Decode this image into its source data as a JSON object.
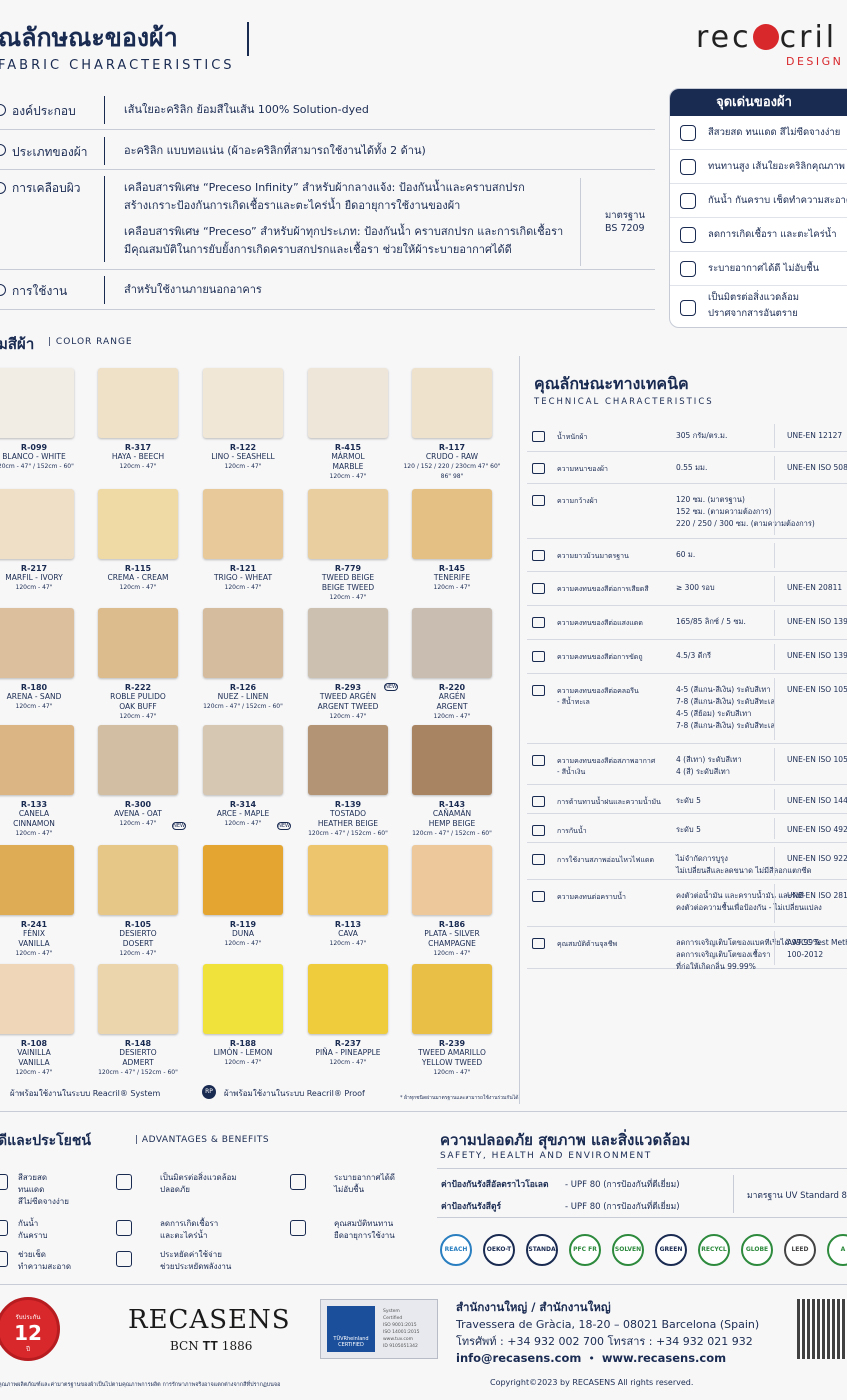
{
  "header": {
    "title_th": "ุณลักษณะของผ้า",
    "title_en": "FABRIC CHARACTERISTICS",
    "logo": "recacril",
    "logo_sub": "DESIGN BY"
  },
  "composition": [
    {
      "label": "องค์ประกอบ",
      "lines": [
        "เส้นใยอะคริลิก ย้อมสีในเส้น 100% Solution-dyed"
      ]
    },
    {
      "label": "ประเภทของผ้า",
      "lines": [
        "อะคริลิก แบบทอแน่น (ผ้าอะคริลิกที่สามารถใช้งานได้ทั้ง 2 ด้าน)"
      ]
    },
    {
      "label": "การเคลือบผิว",
      "lines": [
        "เคลือบสารพิเศษ “Preceso Infinity” สำหรับผ้ากลางแจ้ง: ป้องกันน้ำและคราบสกปรก",
        "สร้างเกราะป้องกันการเกิดเชื้อราและตะไคร่น้ำ ยืดอายุการใช้งานของผ้า",
        "",
        "เคลือบสารพิเศษ “Preceso” สำหรับผ้าทุกประเภท: ป้องกันน้ำ คราบสกปรก และการเกิดเชื้อรา",
        "มีคุณสมบัติในการยับยั้งการเกิดคราบสกปรกและเชื้อรา ช่วยให้ผ้าระบายอากาศได้ดี"
      ]
    },
    {
      "label": "การใช้งาน",
      "lines": [
        "สำหรับใช้งานภายนอกอาคาร"
      ]
    }
  ],
  "standard": {
    "label": "มาตรฐาน",
    "value": "BS 7209"
  },
  "highlights": {
    "title": "จุดเด่นของผ้า",
    "items": [
      {
        "icon": "sun-icon",
        "lines": [
          "สีสวยสด ทนแดด สีไม่ซีดจางง่าย"
        ]
      },
      {
        "icon": "sun-fiber-icon",
        "lines": [
          "ทนทานสูง เส้นใยอะคริลิกคุณภาพ"
        ]
      },
      {
        "icon": "stain-icon",
        "lines": [
          "กันน้ำ กันคราบ เช็ดทำความสะอาด"
        ]
      },
      {
        "icon": "mold-icon",
        "lines": [
          "ลดการเกิดเชื้อรา และตะไคร่น้ำ"
        ]
      },
      {
        "icon": "breathable-icon",
        "lines": [
          "ระบายอากาศได้ดี ไม่อับชื้น"
        ]
      },
      {
        "icon": "eco-icon",
        "lines": [
          "เป็นมิตรต่อสิ่งแวดล้อม",
          "ปราศจากสารอันตราย"
        ]
      }
    ]
  },
  "color_range": {
    "title": "ุมสีผ้า",
    "subtitle": "COLOR RANGE",
    "swatches": [
      {
        "code": "R-099",
        "name": [
          "BLANCO - WHITE"
        ],
        "size": "120cm - 47\" / 152cm - 60\"",
        "color": "#f2ede4"
      },
      {
        "code": "R-317",
        "name": [
          "HAYA - BEECH"
        ],
        "size": "120cm - 47\"",
        "color": "#efe0c8"
      },
      {
        "code": "R-122",
        "name": [
          "LINO - SEASHELL"
        ],
        "size": "120cm - 47\"",
        "color": "#f1e7d6"
      },
      {
        "code": "R-415",
        "name": [
          "MÁRMOL",
          "MARBLE"
        ],
        "size": "120cm - 47\"",
        "color": "#efe6da"
      },
      {
        "code": "R-117",
        "name": [
          "CRUDO - RAW"
        ],
        "size": "120 / 152 / 220 / 230cm 47\" 60\" 86\" 98\"",
        "color": "#eee2cd"
      },
      {
        "code": "R-217",
        "name": [
          "MARFIL - IVORY"
        ],
        "size": "120cm - 47\"",
        "color": "#eedfc6"
      },
      {
        "code": "R-115",
        "name": [
          "CREMA - CREAM"
        ],
        "size": "120cm - 47\"",
        "color": "#efd9a5"
      },
      {
        "code": "R-121",
        "name": [
          "TRIGO - WHEAT"
        ],
        "size": "120cm - 47\"",
        "color": "#e8c99a"
      },
      {
        "code": "R-779",
        "name": [
          "TWEED BEIGE",
          "BEIGE TWEED"
        ],
        "size": "120cm - 47\"",
        "color": "#e9cf9f"
      },
      {
        "code": "R-145",
        "name": [
          "TENERIFE"
        ],
        "size": "120cm - 47\"",
        "color": "#e4c084"
      },
      {
        "code": "R-180",
        "name": [
          "ARENA - SAND"
        ],
        "size": "120cm - 47\"",
        "color": "#dcc09e"
      },
      {
        "code": "R-222",
        "name": [
          "ROBLE PULIDO",
          "OAK BUFF"
        ],
        "size": "120cm - 47\"",
        "color": "#dcbb8d"
      },
      {
        "code": "R-126",
        "name": [
          "NUEZ - LINEN"
        ],
        "size": "120cm - 47\" / 152cm - 60\"",
        "color": "#d6bc9e"
      },
      {
        "code": "R-293",
        "name": [
          "TWEED ARGÉN",
          "ARGENT TWEED"
        ],
        "size": "120cm - 47\"",
        "color": "#ccc0b0"
      },
      {
        "code": "R-220",
        "name": [
          "ARGÉN",
          "ARGENT"
        ],
        "size": "120cm - 47\"",
        "color": "#c8bdb0"
      },
      {
        "code": "R-133",
        "name": [
          "CANELA",
          "CINNAMON"
        ],
        "size": "120cm - 47\"",
        "color": "#dcb585"
      },
      {
        "code": "R-300",
        "name": [
          "AVENA - OAT"
        ],
        "size": "120cm - 47\"",
        "color": "#d2bfa3"
      },
      {
        "code": "R-314",
        "name": [
          "ARCE - MAPLE"
        ],
        "size": "120cm - 47\"",
        "color": "#d6c7b3"
      },
      {
        "code": "R-139",
        "name": [
          "TOSTADO",
          "HEATHER BEIGE"
        ],
        "size": "120cm - 47\" / 152cm - 60\"",
        "color": "#b39474"
      },
      {
        "code": "R-143",
        "name": [
          "CAÑAMÁN",
          "HEMP BEIGE"
        ],
        "size": "120cm - 47\" / 152cm - 60\"",
        "color": "#a98463"
      },
      {
        "code": "R-241",
        "name": [
          "FÉNIX",
          "VANILLA"
        ],
        "size": "120cm - 47\"",
        "color": "#ddac55"
      },
      {
        "code": "R-105",
        "name": [
          "DESIERTO",
          "DOSERT"
        ],
        "size": "120cm - 47\"",
        "color": "#e7c788"
      },
      {
        "code": "R-119",
        "name": [
          "DUNA"
        ],
        "size": "120cm - 47\"",
        "color": "#e5a631"
      },
      {
        "code": "R-113",
        "name": [
          "CAVA"
        ],
        "size": "120cm - 47\"",
        "color": "#edc56c"
      },
      {
        "code": "R-186",
        "name": [
          "PLATA - SILVER",
          "CHAMPAGNE"
        ],
        "size": "120cm - 47\"",
        "color": "#ecc89a"
      },
      {
        "code": "R-108",
        "name": [
          "VAINILLA",
          "VANILLA"
        ],
        "size": "120cm - 47\"",
        "color": "#f0d6b8"
      },
      {
        "code": "R-148",
        "name": [
          "DESIERTO",
          "ADMERT"
        ],
        "size": "120cm - 47\" / 152cm - 60\"",
        "color": "#ead5ac"
      },
      {
        "code": "R-188",
        "name": [
          "LIMÓN - LEMON"
        ],
        "size": "120cm - 47\"",
        "color": "#f0e13b"
      },
      {
        "code": "R-237",
        "name": [
          "PIÑA - PINEAPPLE"
        ],
        "size": "120cm - 47\"",
        "color": "#efcc3c"
      },
      {
        "code": "R-239",
        "name": [
          "TWEED AMARILLO",
          "YELLOW TWEED"
        ],
        "size": "120cm - 47\"",
        "color": "#eabf45"
      }
    ],
    "foot1": "ผ้าพร้อมใช้งานในระบบ Reacril® System",
    "foot2": "ผ้าพร้อมใช้งานในระบบ Reacril® Proof",
    "foot_badge": "RP",
    "note": "* ผ้าทุกชนิดผ่านมาตรฐานและสามารถใช้งานร่วมกันได้",
    "new_badge": "NEW"
  },
  "technical": {
    "title": "คุณลักษณะทางเทคนิค",
    "subtitle": "TECHNICAL CHARACTERISTICS",
    "rows": [
      {
        "label": [
          "น้ำหนักผ้า"
        ],
        "value": [
          "305 กรัม/ตร.ม."
        ],
        "std": [
          "UNE-EN 12127"
        ]
      },
      {
        "label": [
          "ความหนาของผ้า"
        ],
        "value": [
          "0.55 มม."
        ],
        "std": [
          "UNE-EN ISO 5084"
        ]
      },
      {
        "label": [
          "ความกว้างผ้า"
        ],
        "value": [
          "120 ซม. (มาตรฐาน)",
          "152 ซม. (ตามความต้องการ)",
          "220 / 250 / 300 ซม. (ตามความต้องการ)"
        ],
        "std": []
      },
      {
        "label": [
          "ความยาวม้วนมาตรฐาน"
        ],
        "value": [
          "60 ม."
        ],
        "std": []
      },
      {
        "label": [
          "ความคงทนของสีต่อการเสียดสี"
        ],
        "value": [
          "≥ 300 รอบ"
        ],
        "std": [
          "UNE-EN 20811"
        ]
      },
      {
        "label": [
          "ความคงทนของสีต่อแสงแดด"
        ],
        "value": [
          "165/85 ลิกซ์ / 5 ซม."
        ],
        "std": [
          "UNE-EN ISO 1393"
        ]
      },
      {
        "label": [
          "ความคงทนของสีต่อการขัดถู"
        ],
        "value": [
          "4.5/3 ดีกรี"
        ],
        "std": [
          "UNE-EN ISO 1395"
        ]
      },
      {
        "label": [
          "ความคงทนของสีต่อคลอรีน",
          "- สีน้ำทะเล"
        ],
        "value": [
          "4-5 (สีแกน-สีเงิน) ระดับสีเทา",
          "7-8 (สีแกน-สีเงิน) ระดับสีทะเล",
          "4-5 (สีย้อม) ระดับสีเทา",
          "7-8 (สีแกน-สีเงิน) ระดับสีทะเล"
        ],
        "std": [
          "UNE-EN ISO 105 B02"
        ]
      },
      {
        "label": [
          "ความคงทนของสีต่อสภาพอากาศ",
          "- สีน้ำเงิน"
        ],
        "value": [
          "4 (สีเทา) ระดับสีเทา",
          "4 (สี) ระดับสีเทา"
        ],
        "std": [
          "UNE-EN ISO 105 E"
        ]
      },
      {
        "label": [
          "การต้านทานน้ำฝนและความน้ำมัน"
        ],
        "value": [
          "ระดับ 5"
        ],
        "std": [
          "UNE-EN ISO 144"
        ]
      },
      {
        "label": [
          "การกันน้ำ"
        ],
        "value": [
          "ระดับ 5"
        ],
        "std": [
          "UNE-EN ISO 492"
        ]
      },
      {
        "label": [
          "การใช้งานสภาพอ่อนไหวไฟแดด"
        ],
        "value": [
          "ไม่จำกัดการบูรุง",
          "ไม่เปลี่ยนสีและลดขนาด ไม่มีสีลอกแตกซีด"
        ],
        "std": [
          "UNE-EN ISO 922"
        ]
      },
      {
        "label": [
          "ความคงทนต่อคราบน้ำ"
        ],
        "value": [
          "คงตัวต่อน้ำมัน และคราบน้ำมัน และรังสี",
          "คงตัวต่อความชื้นเพื่อป้องกัน - ไม่เปลี่ยนแปลง"
        ],
        "std": [
          "UNE-EN ISO 2813"
        ]
      },
      {
        "label": [
          "คุณสมบัติต้านจุลชีพ"
        ],
        "value": [
          "ลดการเจริญเติบโตของแบคทีเรียได้ 99.99%",
          "ลดการเจริญเติบโตของเชื้อรา",
          "ที่ก่อให้เกิดกลิ่น 99.99%"
        ],
        "std": [
          "AATCC Test Meth",
          "100-2012"
        ]
      }
    ]
  },
  "advantages": {
    "title": "ุดีและประโยชน์",
    "subtitle": "ADVANTAGES & BENEFITS",
    "items": [
      {
        "icon": "sun-icon",
        "lines": [
          "สีสวยสด",
          "ทนแดด",
          "สีไม่ซีดจางง่าย"
        ]
      },
      {
        "icon": "eco-icon",
        "lines": [
          "เป็นมิตรต่อสิ่งแวดล้อม",
          "ปลอดภัย"
        ]
      },
      {
        "icon": "air-icon",
        "lines": [
          "ระบายอากาศได้ดี",
          "ไม่อับชื้น"
        ]
      },
      {
        "icon": "stain-icon",
        "lines": [
          "กันน้ำ",
          "กันคราบ"
        ]
      },
      {
        "icon": "mold-icon",
        "lines": [
          "ลดการเกิดเชื้อรา",
          "และตะไคร่น้ำ"
        ]
      },
      {
        "icon": "durable-icon",
        "lines": [
          "คุณสมบัติทนทาน",
          "ยืดอายุการใช้งาน"
        ]
      },
      {
        "icon": "clean-icon",
        "lines": [
          "ช่วยเช็ด",
          "ทำความสะอาด"
        ]
      },
      {
        "icon": "saving-icon",
        "lines": [
          "ประหยัดค่าใช้จ่าย",
          "ช่วยประหยัดพลังงาน"
        ]
      }
    ]
  },
  "safety": {
    "title": "ความปลอดภัย สุขภาพ และสิ่งแวดล้อม",
    "subtitle": "SAFETY, HEALTH AND ENVIRONMENT",
    "rows": [
      {
        "label": "ค่าป้องกันรังสีอัลตราไวโอเลต",
        "value": "- UPF 80 (การป้องกันที่ดีเยี่ยม)"
      },
      {
        "label": "ค่าป้องกันรังสีตูร์",
        "value": "- UPF 80 (การป้องกันที่ดีเยี่ยม)"
      }
    ],
    "standard": "มาตรฐาน UV Standard 801",
    "certs": [
      "REACH",
      "OEKO-TEX",
      "STANDARD 100",
      "PFC FREE",
      "SOLVENT FREE",
      "GREEN",
      "RECYCLE",
      "GLOBE",
      "LEED",
      "A"
    ]
  },
  "footer": {
    "seal_top": "รับประกัน",
    "seal_num": "12",
    "seal_bottom": "ปี",
    "brand": "RECASENS",
    "brand_sub": "BCN 𝐓𝐓 1886",
    "tuv_text": [
      "System",
      "Certified",
      "ISO 9001:2015",
      "ISO 14001:2015",
      "www.tuv.com",
      "ID 9105051342"
    ],
    "tuv_label": "TÜVRheinland CERTIFIED",
    "office_title": "สำนักงานใหญ่ / สำนักงานใหญ่",
    "address": "Travessera de Gràcia, 18-20 – 08021 Barcelona (Spain)",
    "phone": "โทรศัพท์ : +34 932 002 700   โทรสาร : +34 932 021 932",
    "email": "info@recasens.com",
    "web": "www.recasens.com",
    "legal": "คุณภาพผลิตภัณฑ์และค่ามาตรฐานของผ้าเป็นไปตามคุณภาพการผลิต การรักษาภาพจริงอาจแตกต่างจากสีที่ปรากฏบนจอ",
    "copyright": "Copyright©2023 by RECASENS All rights reserved."
  }
}
